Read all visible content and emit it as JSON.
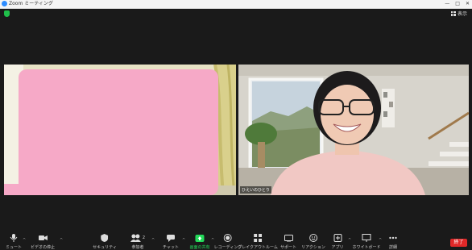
{
  "window": {
    "title": "Zoom ミーティング",
    "controls": [
      "—",
      "□",
      "✕"
    ]
  },
  "header": {
    "view_label": "表示"
  },
  "participants": [
    {
      "name": ""
    },
    {
      "name": "ひえいのひとり"
    }
  ],
  "toolbar": {
    "items": [
      {
        "label": "ミュート",
        "icon": "microphone-icon"
      },
      {
        "label": "ビデオの停止",
        "icon": "video-camera-icon"
      },
      {
        "label": "セキュリティ",
        "icon": "shield-icon"
      },
      {
        "label": "参加者",
        "icon": "participants-icon",
        "count": "2"
      },
      {
        "label": "チャット",
        "icon": "chat-icon"
      },
      {
        "label": "画面の共有",
        "icon": "share-screen-icon"
      },
      {
        "label": "レコーディング",
        "icon": "record-icon"
      },
      {
        "label": "ブレイクアウトルーム",
        "icon": "breakout-rooms-icon"
      },
      {
        "label": "サポート",
        "icon": "support-icon"
      },
      {
        "label": "リアクション",
        "icon": "reaction-icon"
      },
      {
        "label": "アプリ",
        "icon": "apps-icon"
      },
      {
        "label": "ホワイトボード",
        "icon": "whiteboard-icon"
      },
      {
        "label": "詳細",
        "icon": "more-icon"
      }
    ],
    "end_label": "終了"
  },
  "colors": {
    "background": "#1a1a1a",
    "share_accent": "#23d959",
    "end_button": "#e02828",
    "privacy_block": "#f6a9c7"
  }
}
